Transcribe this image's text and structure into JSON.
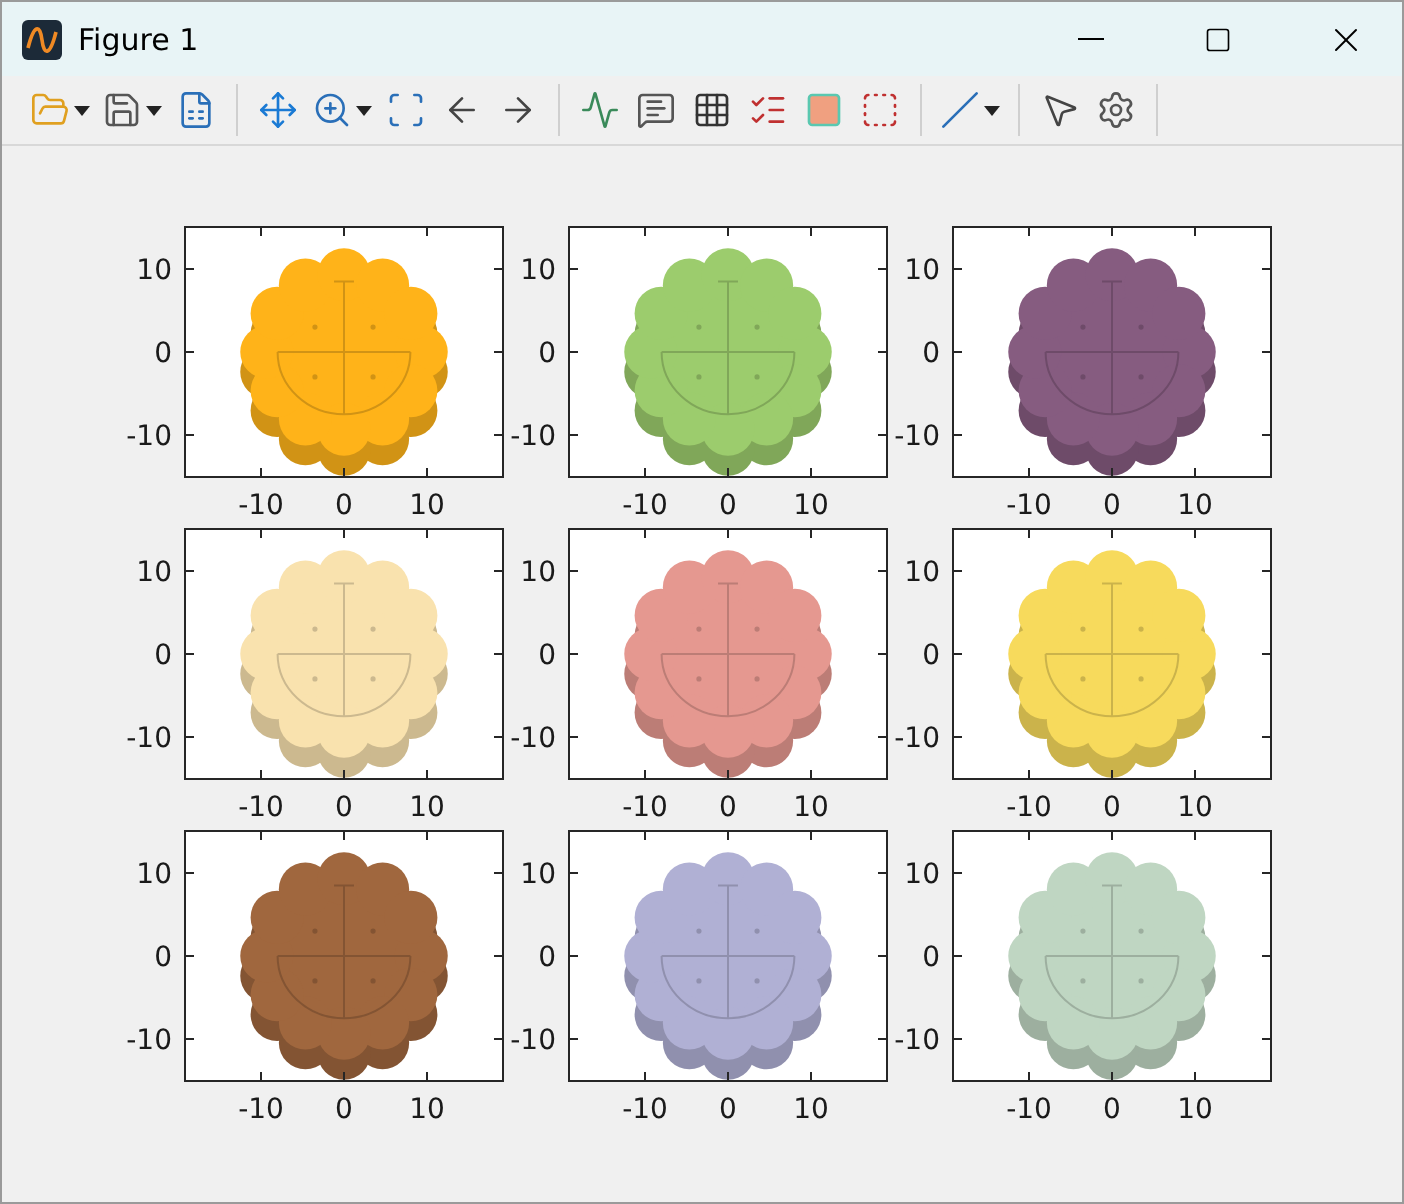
{
  "window": {
    "title": "Figure 1"
  },
  "subplots": [
    {
      "color": "#ffb319",
      "xticks": [
        "-10",
        "0",
        "10"
      ],
      "yticks": [
        "10",
        "0",
        "-10"
      ]
    },
    {
      "color": "#9ccc6d",
      "xticks": [
        "-10",
        "0",
        "10"
      ],
      "yticks": [
        "10",
        "0",
        "-10"
      ]
    },
    {
      "color": "#865c80",
      "xticks": [
        "-10",
        "0",
        "10"
      ],
      "yticks": [
        "10",
        "0",
        "-10"
      ]
    },
    {
      "color": "#f9e2ae",
      "xticks": [
        "-10",
        "0",
        "10"
      ],
      "yticks": [
        "10",
        "0",
        "-10"
      ]
    },
    {
      "color": "#e59890",
      "xticks": [
        "-10",
        "0",
        "10"
      ],
      "yticks": [
        "10",
        "0",
        "-10"
      ]
    },
    {
      "color": "#f7da5c",
      "xticks": [
        "-10",
        "0",
        "10"
      ],
      "yticks": [
        "10",
        "0",
        "-10"
      ]
    },
    {
      "color": "#a0673e",
      "xticks": [
        "-10",
        "0",
        "10"
      ],
      "yticks": [
        "10",
        "0",
        "-10"
      ]
    },
    {
      "color": "#b0b0d4",
      "xticks": [
        "-10",
        "0",
        "10"
      ],
      "yticks": [
        "10",
        "0",
        "-10"
      ]
    },
    {
      "color": "#bfd6c2",
      "xticks": [
        "-10",
        "0",
        "10"
      ],
      "yticks": [
        "10",
        "0",
        "-10"
      ]
    }
  ]
}
